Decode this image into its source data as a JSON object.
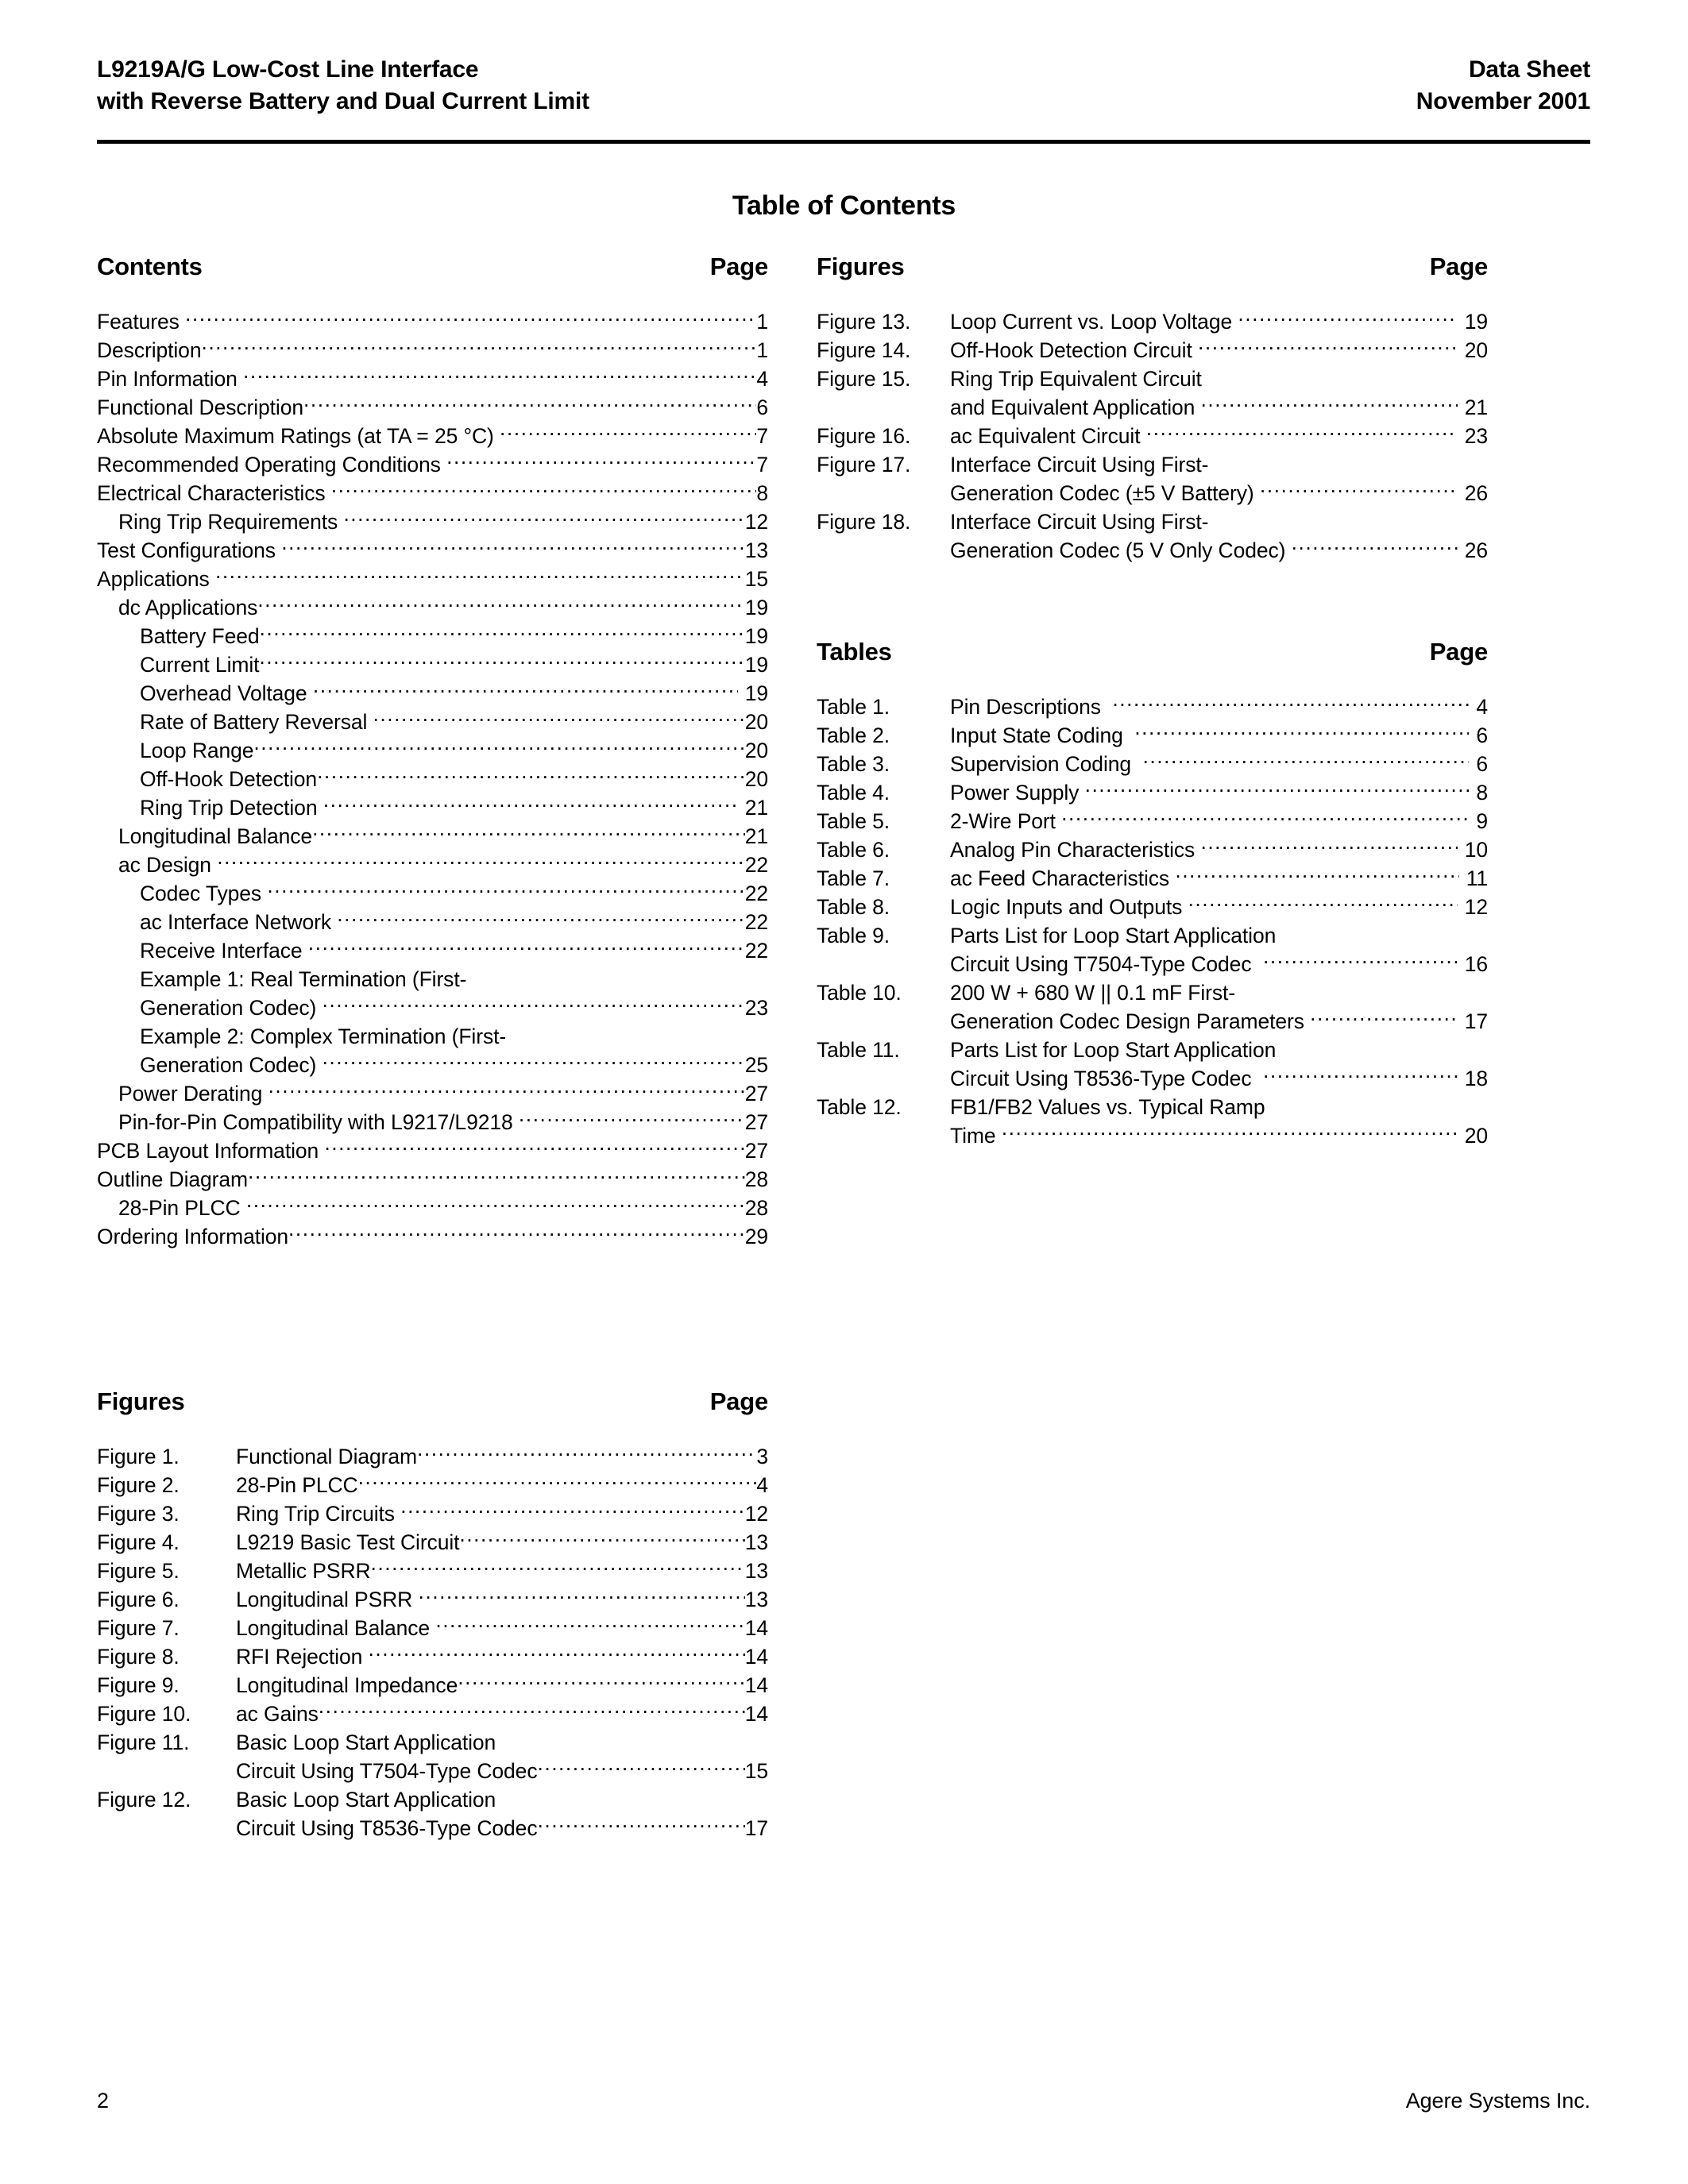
{
  "header": {
    "title_line1": "L9219A/G Low-Cost Line Interface",
    "title_line2": "with Reverse Battery and Dual Current Limit",
    "right_line1": "Data Sheet",
    "right_line2": "November 2001"
  },
  "page_title": "Table of Contents",
  "left_column": {
    "contents": {
      "heading": "Contents",
      "page_heading": "Page",
      "entries": [
        {
          "title": "Features ",
          "page": "1",
          "indent": 0
        },
        {
          "title": "Description",
          "page": "1",
          "indent": 0
        },
        {
          "title": "Pin Information ",
          "page": "4",
          "indent": 0
        },
        {
          "title": "Functional Description",
          "page": "6",
          "indent": 0
        },
        {
          "title": "Absolute Maximum Ratings (at TA = 25 °C) ",
          "page": "7",
          "indent": 0
        },
        {
          "title": "Recommended Operating Conditions ",
          "page": "7",
          "indent": 0
        },
        {
          "title": "Electrical Characteristics ",
          "page": "8",
          "indent": 0
        },
        {
          "title": "Ring Trip Requirements ",
          "page": "12",
          "indent": 1
        },
        {
          "title": "Test Configurations ",
          "page": "13",
          "indent": 0
        },
        {
          "title": "Applications ",
          "page": "15",
          "indent": 0
        },
        {
          "title": "dc Applications",
          "page": "19",
          "indent": 1
        },
        {
          "title": "Battery Feed",
          "page": "19",
          "indent": 2
        },
        {
          "title": "Current Limit",
          "page": "19",
          "indent": 2
        },
        {
          "title": "Overhead Voltage ",
          "page": "19",
          "indent": 2,
          "gapnum": true
        },
        {
          "title": "Rate of Battery Reversal ",
          "page": "20",
          "indent": 2
        },
        {
          "title": "Loop Range",
          "page": "20",
          "indent": 2
        },
        {
          "title": "Off-Hook Detection",
          "page": "20",
          "indent": 2
        },
        {
          "title": "Ring Trip Detection ",
          "page": "21",
          "indent": 2,
          "gapnum": true
        },
        {
          "title": "Longitudinal Balance",
          "page": "21",
          "indent": 1
        },
        {
          "title": "ac Design ",
          "page": "22",
          "indent": 1
        },
        {
          "title": "Codec Types ",
          "page": "22",
          "indent": 2
        },
        {
          "title": "ac Interface Network ",
          "page": "22",
          "indent": 2
        },
        {
          "title": "Receive Interface ",
          "page": "22",
          "indent": 2
        },
        {
          "title": "Example 1: Real Termination (First-",
          "page": "",
          "indent": 2,
          "nolead": true
        },
        {
          "title": "Generation Codec) ",
          "page": "23",
          "indent": 2
        },
        {
          "title": "Example 2: Complex Termination (First-",
          "page": "",
          "indent": 2,
          "nolead": true
        },
        {
          "title": "Generation Codec) ",
          "page": "25",
          "indent": 2
        },
        {
          "title": "Power Derating ",
          "page": "27",
          "indent": 1
        },
        {
          "title": "Pin-for-Pin Compatibility with L9217/L9218 ",
          "page": "27",
          "indent": 1
        },
        {
          "title": "PCB Layout Information ",
          "page": "27",
          "indent": 0
        },
        {
          "title": "Outline Diagram",
          "page": "28",
          "indent": 0
        },
        {
          "title": "28-Pin PLCC ",
          "page": "28",
          "indent": 1
        },
        {
          "title": "Ordering Information",
          "page": "29",
          "indent": 0
        }
      ]
    },
    "figures": {
      "heading": "Figures",
      "page_heading": "Page",
      "entries": [
        {
          "label": "Figure 1.",
          "title": "Functional Diagram",
          "page": "3"
        },
        {
          "label": "Figure 2.",
          "title": "28-Pin PLCC",
          "page": "4"
        },
        {
          "label": "Figure 3.",
          "title": "Ring Trip Circuits ",
          "page": "12"
        },
        {
          "label": "Figure 4.",
          "title": "L9219 Basic Test Circuit",
          "page": "13"
        },
        {
          "label": "Figure 5.",
          "title": "Metallic PSRR",
          "page": "13"
        },
        {
          "label": "Figure 6.",
          "title": "Longitudinal PSRR ",
          "page": "13"
        },
        {
          "label": "Figure 7.",
          "title": "Longitudinal Balance ",
          "page": "14"
        },
        {
          "label": "Figure 8.",
          "title": "RFI Rejection ",
          "page": "14"
        },
        {
          "label": "Figure 9.",
          "title": "Longitudinal Impedance",
          "page": "14"
        },
        {
          "label": "Figure 10.",
          "title": "ac Gains",
          "page": "14"
        },
        {
          "label": "Figure 11.",
          "title": "Basic Loop Start Application",
          "page": "",
          "nolead": true
        },
        {
          "label": "",
          "title": "Circuit Using T7504-Type Codec",
          "page": "15"
        },
        {
          "label": "Figure 12.",
          "title": "Basic Loop Start Application",
          "page": "",
          "nolead": true
        },
        {
          "label": "",
          "title": "Circuit Using T8536-Type Codec",
          "page": "17"
        }
      ]
    }
  },
  "right_column": {
    "figures": {
      "heading": "Figures",
      "page_heading": "Page",
      "entries": [
        {
          "label": "Figure 13.",
          "title": "Loop Current vs. Loop Voltage ",
          "page": "19"
        },
        {
          "label": "Figure 14.",
          "title": "Off-Hook Detection Circuit ",
          "page": "20"
        },
        {
          "label": "Figure 15.",
          "title": "Ring Trip Equivalent Circuit",
          "page": "",
          "nolead": true
        },
        {
          "label": "",
          "title": "and Equivalent Application ",
          "page": "21"
        },
        {
          "label": "Figure 16.",
          "title": "ac Equivalent Circuit ",
          "page": "23"
        },
        {
          "label": "Figure 17.",
          "title": "Interface Circuit Using First-",
          "page": "",
          "nolead": true
        },
        {
          "label": "",
          "title": "Generation Codec (±5 V Battery) ",
          "page": "26"
        },
        {
          "label": "Figure 18.",
          "title": "Interface Circuit Using First-",
          "page": "",
          "nolead": true
        },
        {
          "label": "",
          "title": "Generation Codec (5 V Only Codec) ",
          "page": "26"
        }
      ]
    },
    "tables": {
      "heading": "Tables",
      "page_heading": "Page",
      "entries": [
        {
          "label": "Table 1.",
          "title": "Pin Descriptions  ",
          "page": "4"
        },
        {
          "label": "Table 2.",
          "title": "Input State Coding  ",
          "page": "6"
        },
        {
          "label": "Table 3.",
          "title": "Supervision Coding  ",
          "page": "6"
        },
        {
          "label": "Table 4.",
          "title": "Power Supply ",
          "page": "8"
        },
        {
          "label": "Table 5.",
          "title": "2-Wire Port ",
          "page": "9"
        },
        {
          "label": "Table 6.",
          "title": "Analog Pin Characteristics ",
          "page": "10"
        },
        {
          "label": "Table 7.",
          "title": "ac Feed Characteristics ",
          "page": "11"
        },
        {
          "label": "Table 8.",
          "title": "Logic Inputs and Outputs ",
          "page": "12"
        },
        {
          "label": "Table 9.",
          "title": "Parts List for Loop Start Application",
          "page": "",
          "nolead": true
        },
        {
          "label": "",
          "title": "Circuit Using T7504-Type Codec  ",
          "page": "16"
        },
        {
          "label": "Table 10.",
          "title": "200 W + 680 W || 0.1 mF First-",
          "page": "",
          "nolead": true
        },
        {
          "label": "",
          "title": "Generation Codec Design Parameters ",
          "page": "17"
        },
        {
          "label": "Table 11.",
          "title": "Parts List for Loop Start Application",
          "page": "",
          "nolead": true
        },
        {
          "label": "",
          "title": "Circuit Using T8536-Type Codec  ",
          "page": "18"
        },
        {
          "label": "Table 12.",
          "title": "FB1/FB2 Values vs. Typical Ramp",
          "page": "",
          "nolead": true
        },
        {
          "label": "",
          "title": "Time ",
          "page": "20"
        }
      ]
    }
  },
  "footer": {
    "page_number": "2",
    "company": "Agere Systems Inc."
  }
}
